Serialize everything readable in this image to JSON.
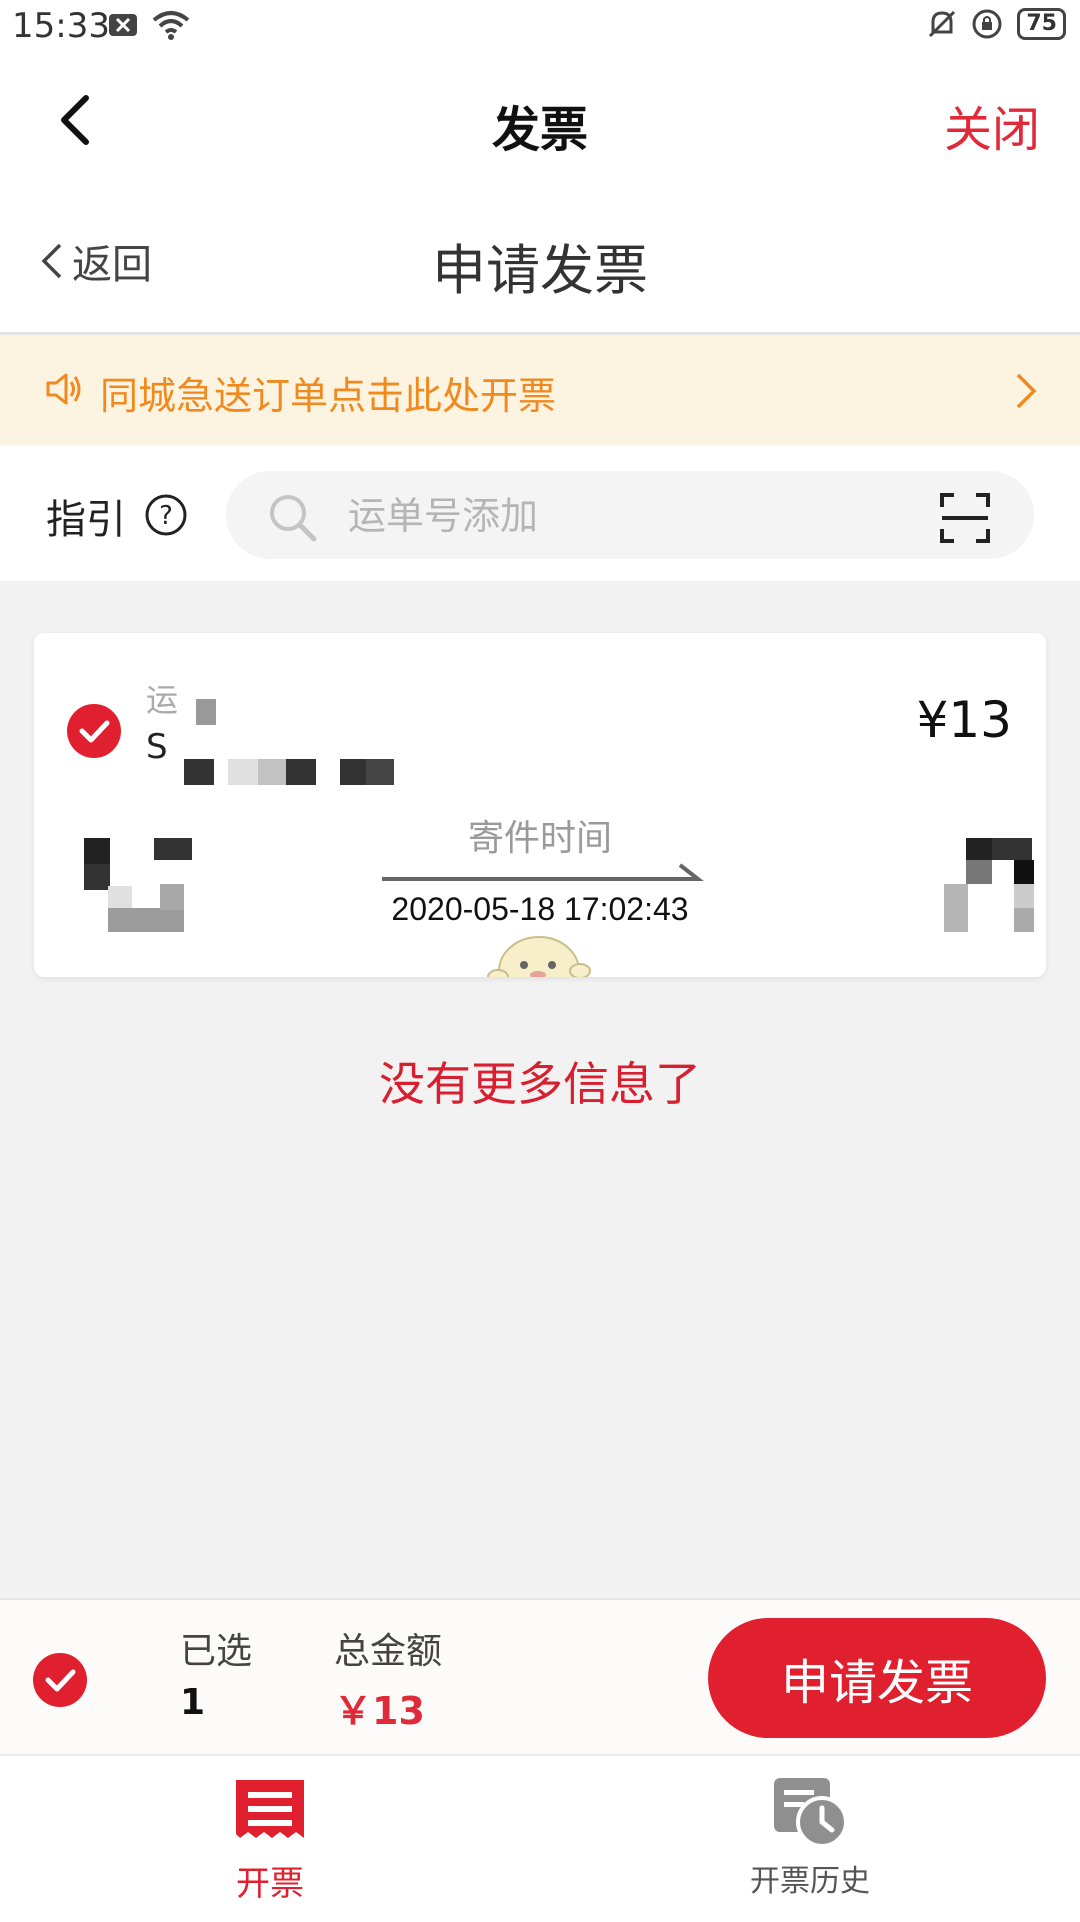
{
  "status_bar": {
    "time": "15:33",
    "battery": "75"
  },
  "title_bar": {
    "title": "发票",
    "close_label": "关闭"
  },
  "sub_header": {
    "back_label": "返回",
    "title": "申请发票"
  },
  "notice": {
    "text": "同城急送订单点击此处开票"
  },
  "search": {
    "guide_label": "指引",
    "placeholder": "运单号添加"
  },
  "card": {
    "label": "运",
    "number": "S",
    "amount": "¥13",
    "time_label": "寄件时间",
    "time_value": "2020-05-18 17:02:43"
  },
  "no_more_text": "没有更多信息了",
  "summary": {
    "selected_label": "已选",
    "selected_count": "1",
    "total_label": "总金额",
    "total_amount": "￥13",
    "apply_button": "申请发票"
  },
  "tabs": [
    {
      "label": "开票",
      "active": true
    },
    {
      "label": "开票历史",
      "active": false
    }
  ],
  "colors": {
    "accent": "#e0202f",
    "notice_text": "#f08a1e",
    "notice_bg": "#fdf3e1"
  }
}
